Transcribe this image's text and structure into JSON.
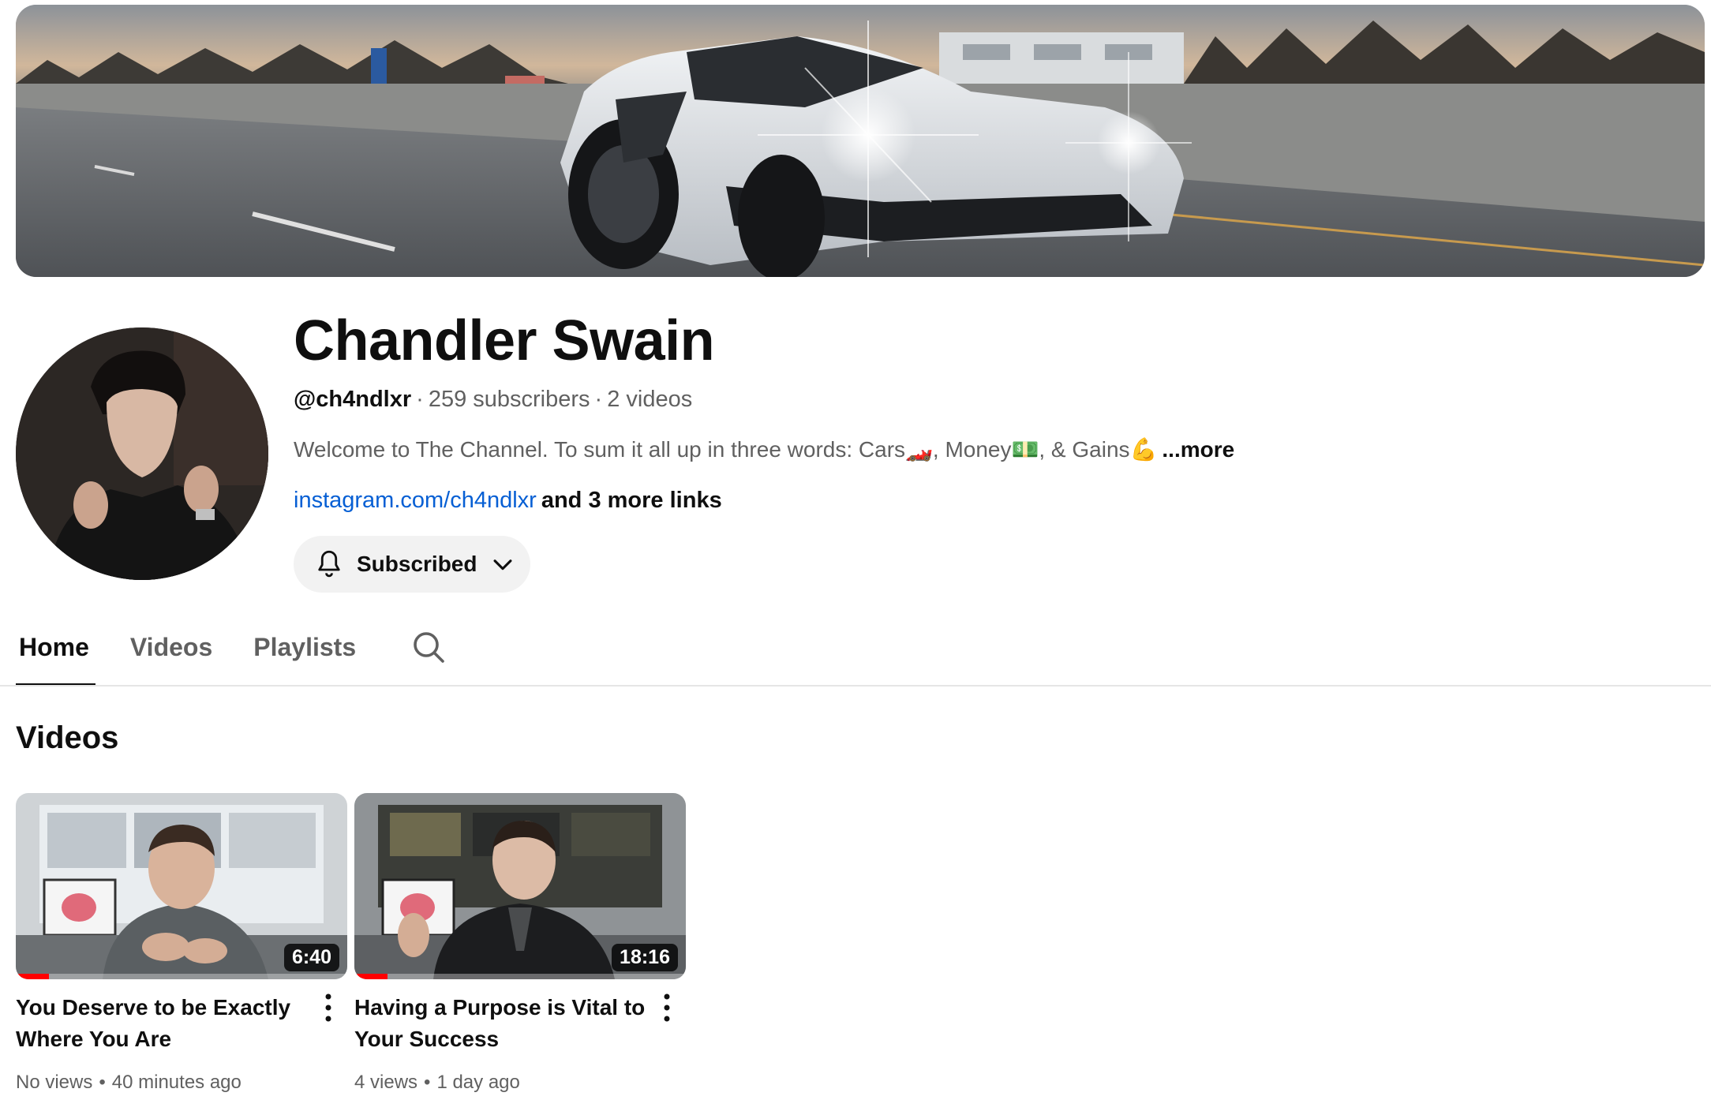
{
  "channel": {
    "name": "Chandler Swain",
    "handle": "@ch4ndlxr",
    "subscribers": "259 subscribers",
    "video_count": "2 videos",
    "description": "Welcome to The Channel. To sum it all up in three words: Cars🏎️, Money💵, & Gains💪",
    "description_more": "...more",
    "link_text": "instagram.com/ch4ndlxr",
    "more_links": "and 3 more links",
    "subscribe_label": "Subscribed"
  },
  "tabs": [
    {
      "label": "Home",
      "active": true
    },
    {
      "label": "Videos",
      "active": false
    },
    {
      "label": "Playlists",
      "active": false
    }
  ],
  "section_title": "Videos",
  "videos": [
    {
      "title": "You Deserve to be Exactly Where You Are",
      "duration": "6:40",
      "views": "No views",
      "age": "40 minutes ago",
      "watched_fraction": 0.1
    },
    {
      "title": "Having a Purpose is Vital to Your Success",
      "duration": "18:16",
      "views": "4 views",
      "age": "1 day ago",
      "watched_fraction": 0.1
    }
  ],
  "icons": {
    "bell": "bell-icon",
    "chevron": "chevron-down-icon",
    "search": "search-icon",
    "kebab": "more-vert-icon"
  },
  "colors": {
    "link": "#065fd4",
    "progress": "#ff0000",
    "muted_text": "#606060",
    "button_bg": "#f2f2f2"
  }
}
